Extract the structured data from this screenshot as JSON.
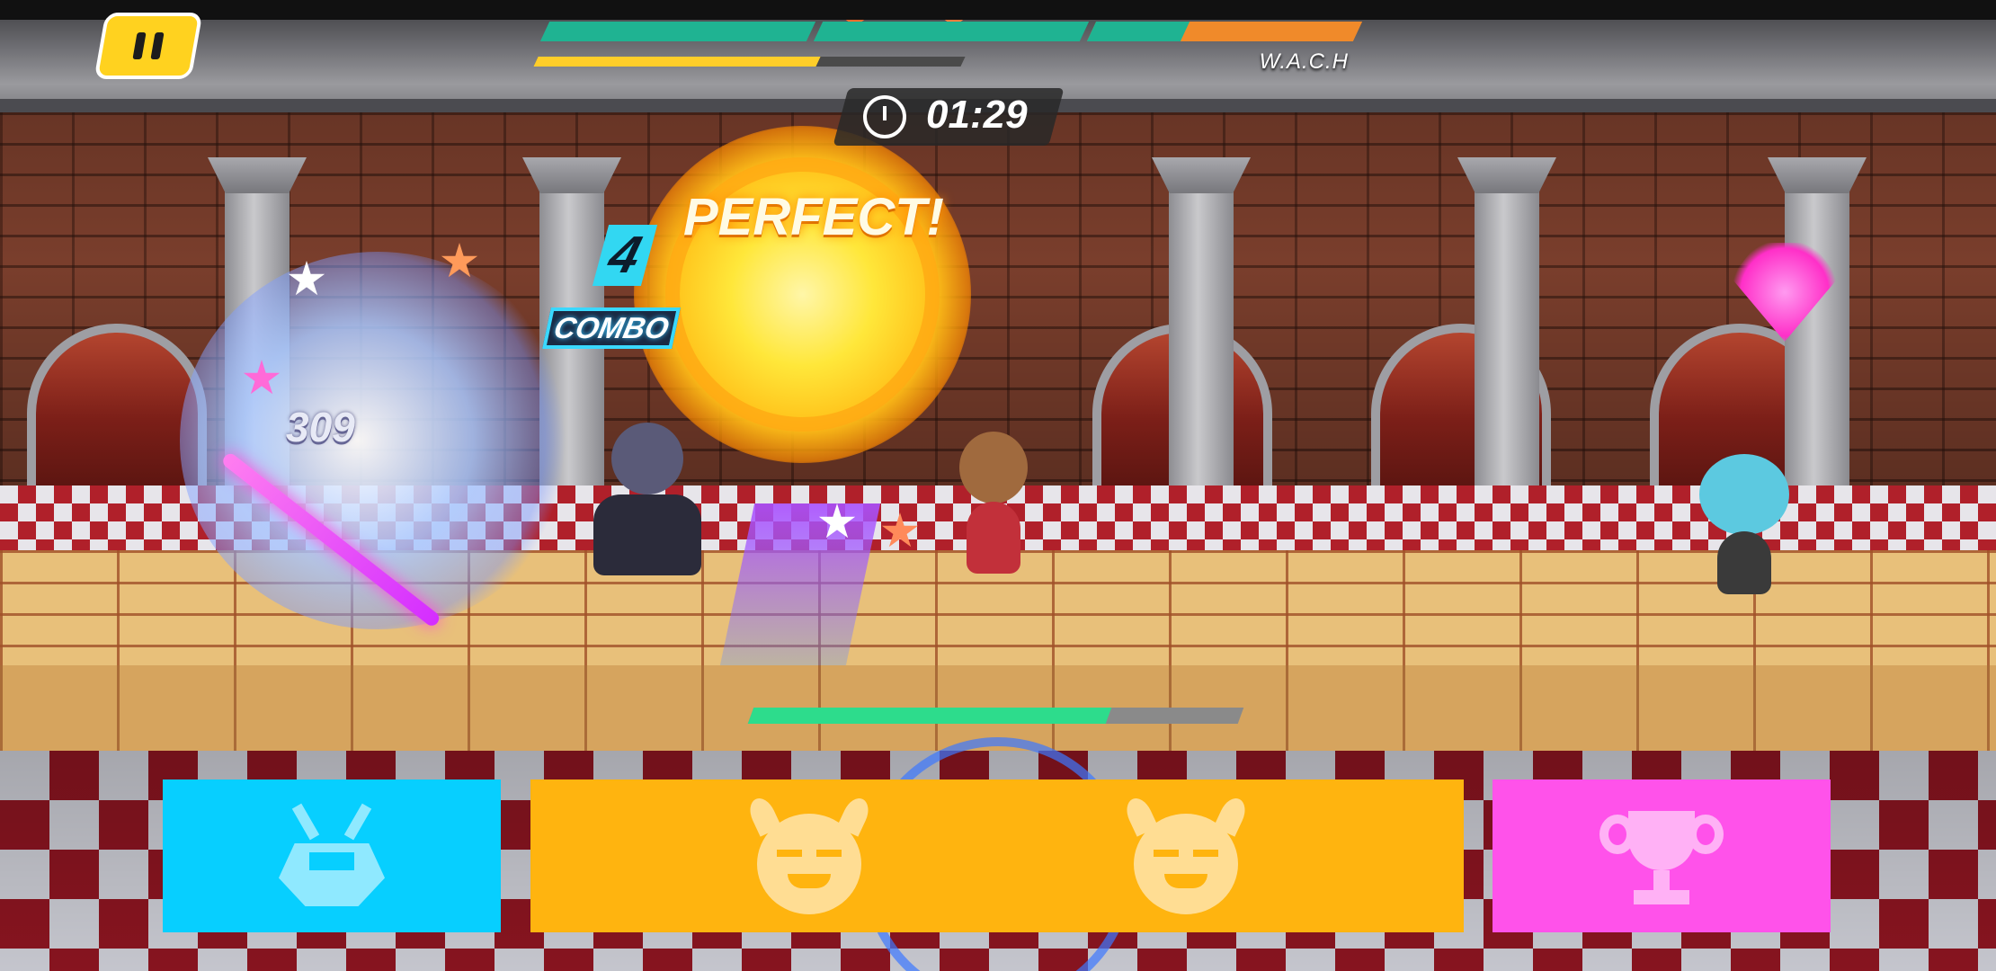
{
  "hud": {
    "opponent_name": "W.A.C.H",
    "timer": "01:29",
    "player_health_fraction": 0.73,
    "energy_fraction": 0.66,
    "opponent_health_segments": [
      {
        "color": "#1fb392",
        "fraction": 1.0
      },
      {
        "color": "#1fb392",
        "fraction": 1.0
      },
      {
        "color": "#1fb392",
        "fraction": 0.35,
        "remaining_color": "#f08a2a"
      }
    ],
    "pause_icon": "pause-icon"
  },
  "combat": {
    "combo_count": "4",
    "combo_label": "COMBO",
    "hit_rating": "PERFECT!",
    "damage_number": "309"
  },
  "skills": [
    {
      "name": "robot-skill",
      "icon": "robot-icon",
      "color": "#07cfff"
    },
    {
      "name": "demon-skill",
      "icon": "demon-icon",
      "color": "#ffb40f"
    },
    {
      "name": "demon-skill-2",
      "icon": "demon-icon",
      "color": "#ffb40f"
    },
    {
      "name": "trophy-skill",
      "icon": "trophy-icon",
      "color": "#ff52ea"
    }
  ]
}
